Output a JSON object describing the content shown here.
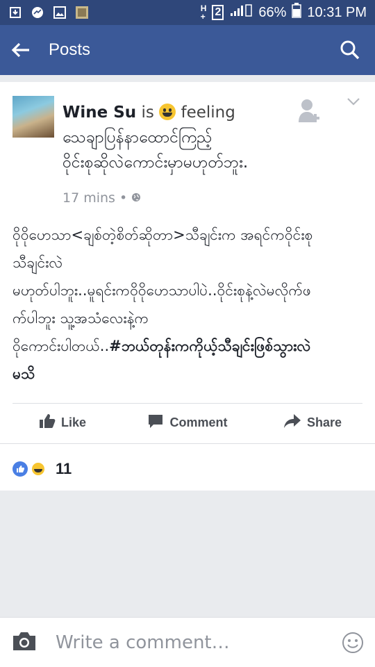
{
  "status_bar": {
    "battery": "66%",
    "time": "10:31 PM",
    "sim_label": "2"
  },
  "app_bar": {
    "title": "Posts"
  },
  "post": {
    "author": "Wine Su",
    "is_text": "is",
    "feeling_text": "feeling",
    "feeling_detail_line1": "သေချာပြန်နာထောင်ကြည့်",
    "feeling_detail_line2": "ဝိုင်းစုဆိုလဲကောင်းမှာမဟုတ်ဘူး.",
    "timestamp": "17 mins",
    "meta_separator": "•",
    "body_line1": "ဝိုဝိုဟေသာ<ချစ်တဲ့စိတ်ဆိုတာ>သီချင်းက အရင်ကဝိုင်းစု",
    "body_line2": "သီချင်းလဲ",
    "body_line3": "မဟုတ်ပါဘူး..မူရင်းကဝိုဝိုဟေသာပါပဲ..ဝိုင်းစုနဲ့လဲမလိုက်ဖ",
    "body_line4": "က်ပါဘူး သူ့အသံလေးနဲ့က",
    "body_line5_plain": "ဝိုကောင်းပါတယ်..",
    "body_line5_hashtag": "#ဘယ်တုန်းကကိုယ့်သီချင်းဖြစ်သွားလဲ",
    "body_line6_hashtag": "မသိ",
    "reaction_count": "11"
  },
  "actions": {
    "like": "Like",
    "comment": "Comment",
    "share": "Share"
  },
  "comment_bar": {
    "placeholder": "Write a comment…"
  },
  "colors": {
    "status_bar": "#2f477a",
    "app_bar": "#3b5998",
    "background": "#e9ebee",
    "action_text": "#4b4f56"
  }
}
